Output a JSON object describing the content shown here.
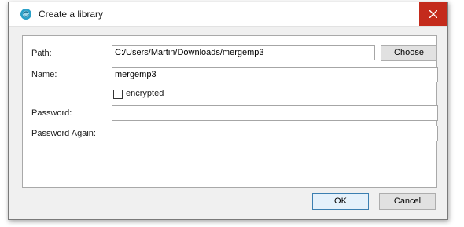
{
  "window": {
    "title": "Create a library"
  },
  "form": {
    "path_label": "Path:",
    "path_value": "C:/Users/Martin/Downloads/mergemp3",
    "choose_label": "Choose",
    "name_label": "Name:",
    "name_value": "mergemp3",
    "encrypted_label": "encrypted",
    "encrypted_checked": false,
    "password_label": "Password:",
    "password_value": "",
    "password_again_label": "Password Again:",
    "password_again_value": ""
  },
  "footer": {
    "ok_label": "OK",
    "cancel_label": "Cancel"
  },
  "icons": {
    "app": "sync-circle-icon",
    "close": "close-icon"
  },
  "colors": {
    "close_bg": "#c42b1c",
    "app_icon": "#2aa0c8"
  }
}
